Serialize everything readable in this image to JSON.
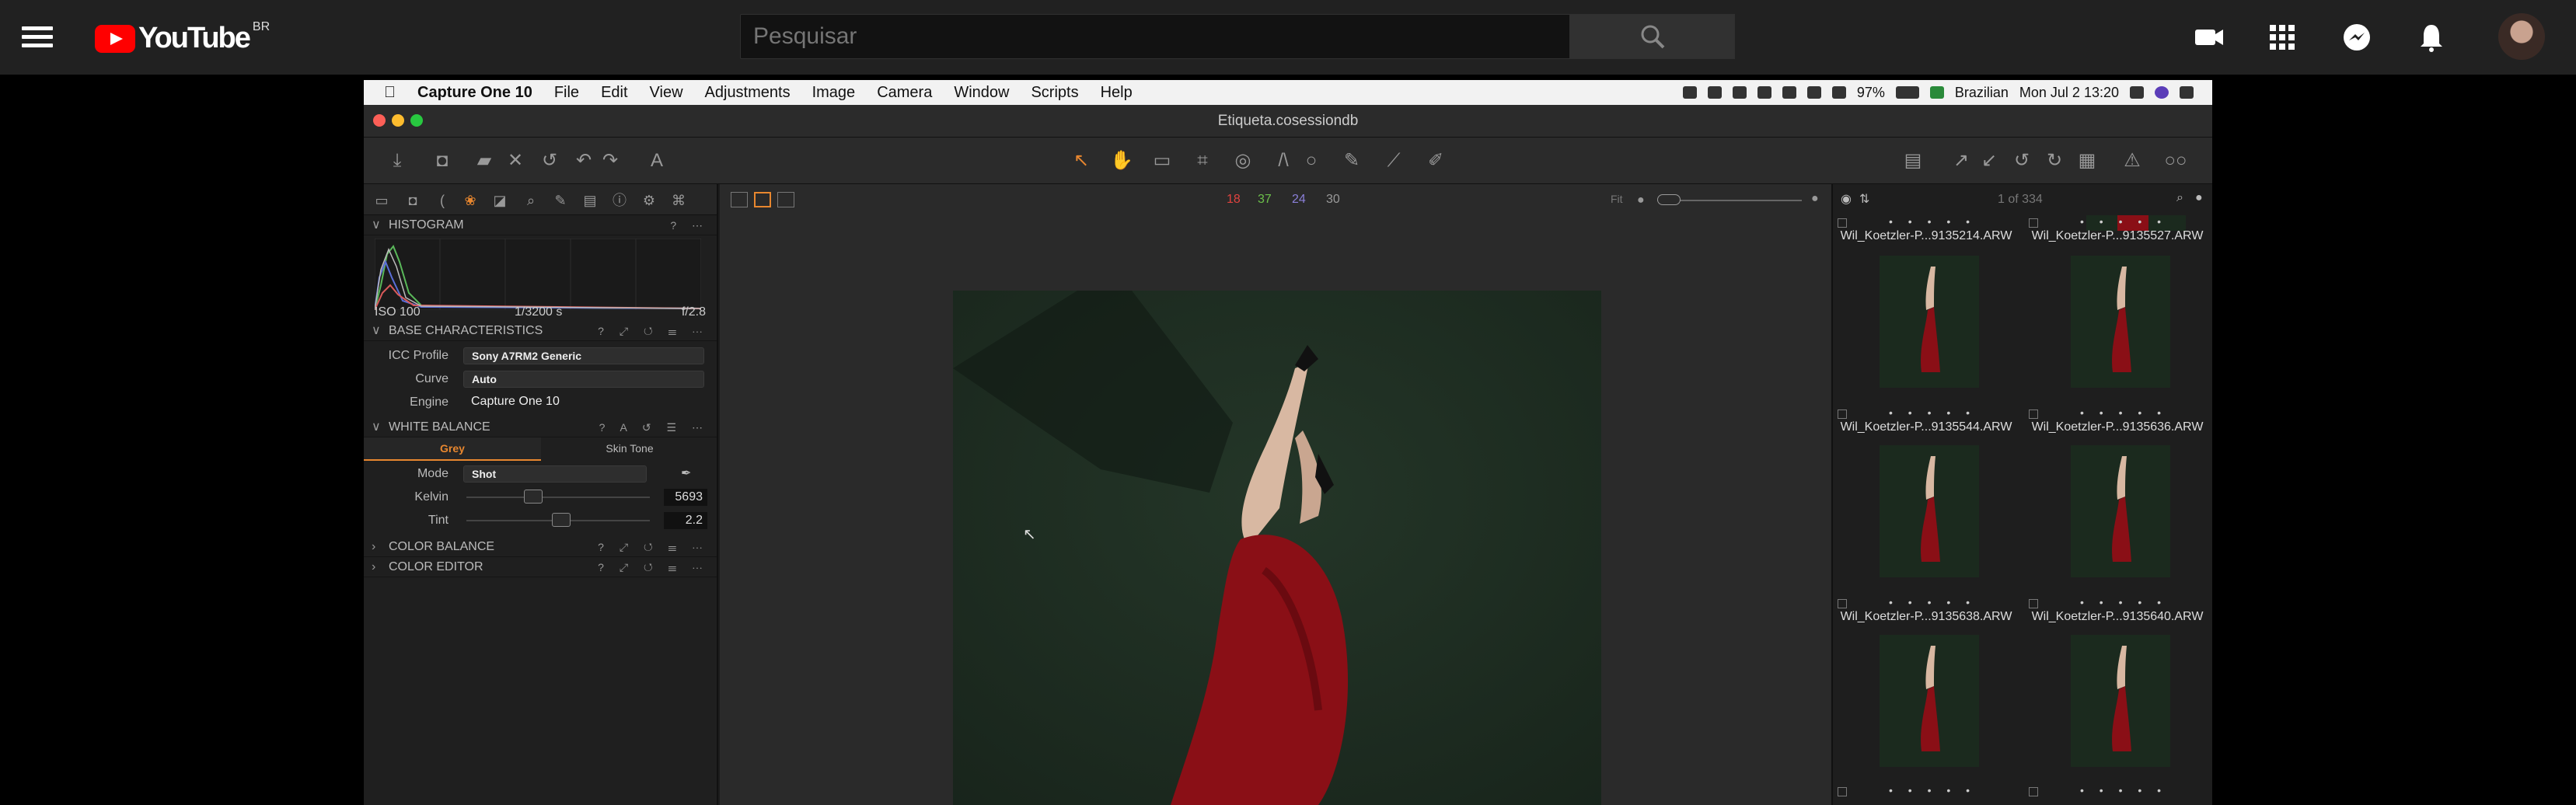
{
  "youtube": {
    "search_placeholder": "Pesquisar",
    "logo_text": "YouTube",
    "region": "BR"
  },
  "menubar": {
    "apple": "",
    "app": "Capture One 10",
    "items": [
      "File",
      "Edit",
      "View",
      "Adjustments",
      "Image",
      "Camera",
      "Window",
      "Scripts",
      "Help"
    ],
    "battery": "97%",
    "language": "Brazilian",
    "datetime": "Mon Jul 2  13:20"
  },
  "window": {
    "title": "Etiqueta.cosessiondb"
  },
  "left": {
    "histogram": {
      "title": "HISTOGRAM",
      "iso": "ISO 100",
      "shutter": "1/3200 s",
      "aperture": "f/2.8"
    },
    "base": {
      "title": "BASE CHARACTERISTICS",
      "icc_label": "ICC Profile",
      "icc_value": "Sony A7RM2 Generic",
      "curve_label": "Curve",
      "curve_value": "Auto",
      "engine_label": "Engine",
      "engine_value": "Capture One 10"
    },
    "wb": {
      "title": "WHITE BALANCE",
      "tab_grey": "Grey",
      "tab_skin": "Skin Tone",
      "mode_label": "Mode",
      "mode_value": "Shot",
      "kelvin_label": "Kelvin",
      "kelvin_value": "5693",
      "tint_label": "Tint",
      "tint_value": "2.2"
    },
    "color_balance": {
      "title": "COLOR BALANCE"
    },
    "color_editor": {
      "title": "COLOR EDITOR"
    }
  },
  "center": {
    "counts": [
      "18",
      "37",
      "24",
      "30"
    ],
    "fit": "Fit"
  },
  "right": {
    "counter": "1 of 334",
    "thumbs": [
      "Wil_Koetzler-P...9135214.ARW",
      "Wil_Koetzler-P...9135527.ARW",
      "Wil_Koetzler-P...9135544.ARW",
      "Wil_Koetzler-P...9135636.ARW",
      "Wil_Koetzler-P...9135638.ARW",
      "Wil_Koetzler-P...9135640.ARW"
    ],
    "stars": "• • • • •"
  },
  "colors": {
    "accent_orange": "#e8872f",
    "red_count": "#e0433f",
    "green_count": "#6cc04a",
    "purple_count": "#8a7fd8",
    "dress": "#8a0f16",
    "grass": "#1f2e22"
  }
}
